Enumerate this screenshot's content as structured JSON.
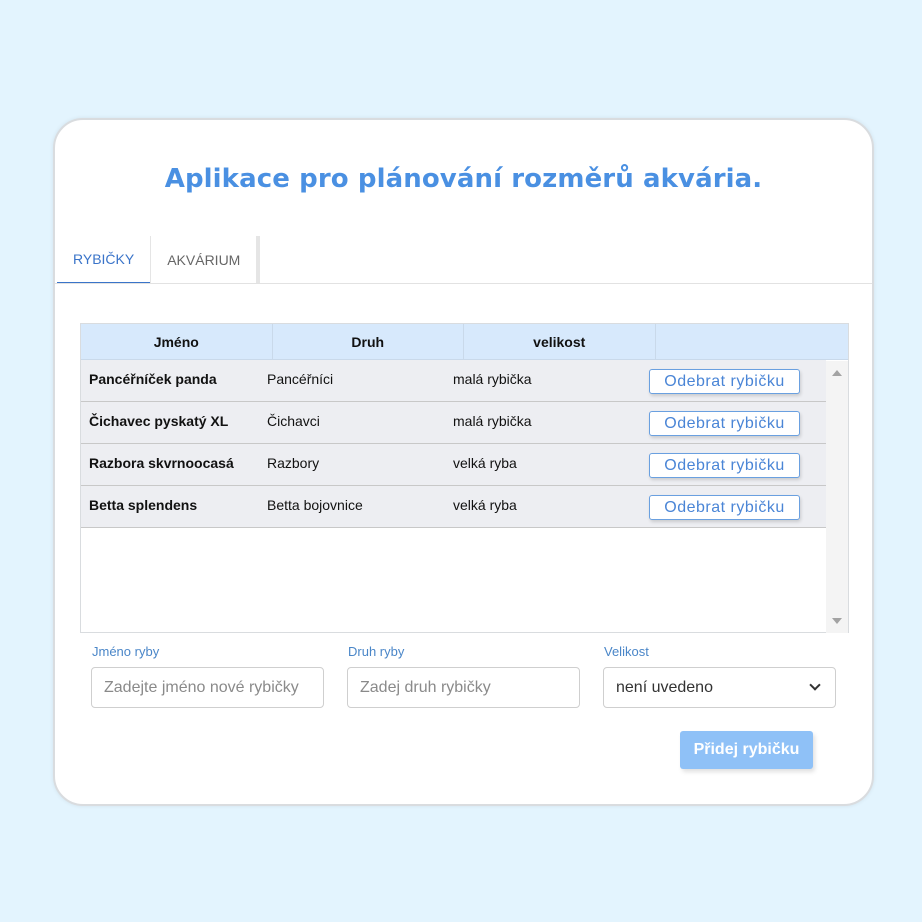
{
  "app": {
    "title": "Aplikace pro plánování rozměrů akvária."
  },
  "tabs": [
    {
      "label": "RYBIČKY",
      "active": true
    },
    {
      "label": "AKVÁRIUM",
      "active": false
    }
  ],
  "table": {
    "headers": [
      "Jméno",
      "Druh",
      "velikost",
      ""
    ],
    "rows": [
      {
        "name": "Pancéřníček panda",
        "druh": "Pancéřníci",
        "velikost": "malá rybička",
        "action": "Odebrat rybičku"
      },
      {
        "name": "Čichavec pyskatý XL",
        "druh": "Čichavci",
        "velikost": "malá rybička",
        "action": "Odebrat rybičku"
      },
      {
        "name": "Razbora skvrnoocasá",
        "druh": "Razbory",
        "velikost": "velká ryba",
        "action": "Odebrat rybičku"
      },
      {
        "name": "Betta splendens",
        "druh": "Betta bojovnice",
        "velikost": "velká ryba",
        "action": "Odebrat rybičku"
      }
    ]
  },
  "form": {
    "name_label": "Jméno ryby",
    "name_placeholder": "Zadejte jméno nové rybičky",
    "druh_label": "Druh ryby",
    "druh_placeholder": "Zadej druh rybičky",
    "size_label": "Velikost",
    "size_value": "není uvedeno",
    "submit_label": "Přidej rybičku"
  },
  "colors": {
    "accent": "#4a90e2",
    "background": "#e3f4fe",
    "header_bg": "#d7e9fc",
    "row_bg": "#edeef2",
    "button_primary": "#8fc1f7"
  }
}
